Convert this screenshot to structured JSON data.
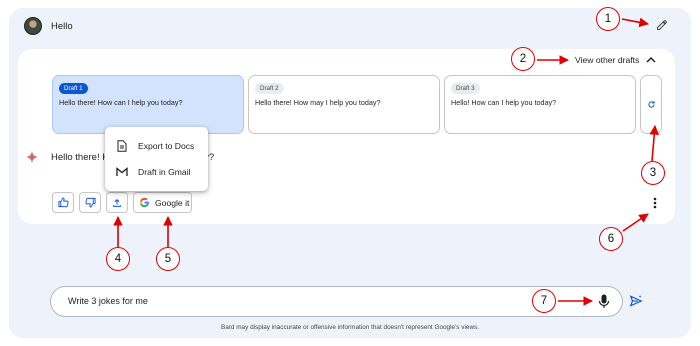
{
  "user": {
    "prompt": "Hello",
    "avatar_icon": "user-avatar"
  },
  "drafts_header": {
    "label": "View other drafts",
    "icon": "chevron-up-icon"
  },
  "drafts": [
    {
      "badge": "Draft 1",
      "text": "Hello there! How can I help you today?",
      "selected": true
    },
    {
      "badge": "Draft 2",
      "text": "Hello there! How may I help you today?",
      "selected": false
    },
    {
      "badge": "Draft 3",
      "text": "Hello! How can I help you today?",
      "selected": false
    }
  ],
  "response": {
    "text": "Hello there! How can I help you today?"
  },
  "share_menu": {
    "items": [
      {
        "label": "Export to Docs",
        "icon": "docs-icon"
      },
      {
        "label": "Draft in Gmail",
        "icon": "gmail-icon"
      }
    ]
  },
  "actions": {
    "google_it": "Google it"
  },
  "input": {
    "value": "Write 3 jokes for me"
  },
  "disclaimer": "Bard may display inaccurate or offensive information that doesn't represent Google's views.",
  "annotations": [
    "1",
    "2",
    "3",
    "4",
    "5",
    "6",
    "7"
  ],
  "colors": {
    "accent": "#0b57d0",
    "annotation": "#e00000",
    "selected_draft": "#d3e3fd"
  }
}
